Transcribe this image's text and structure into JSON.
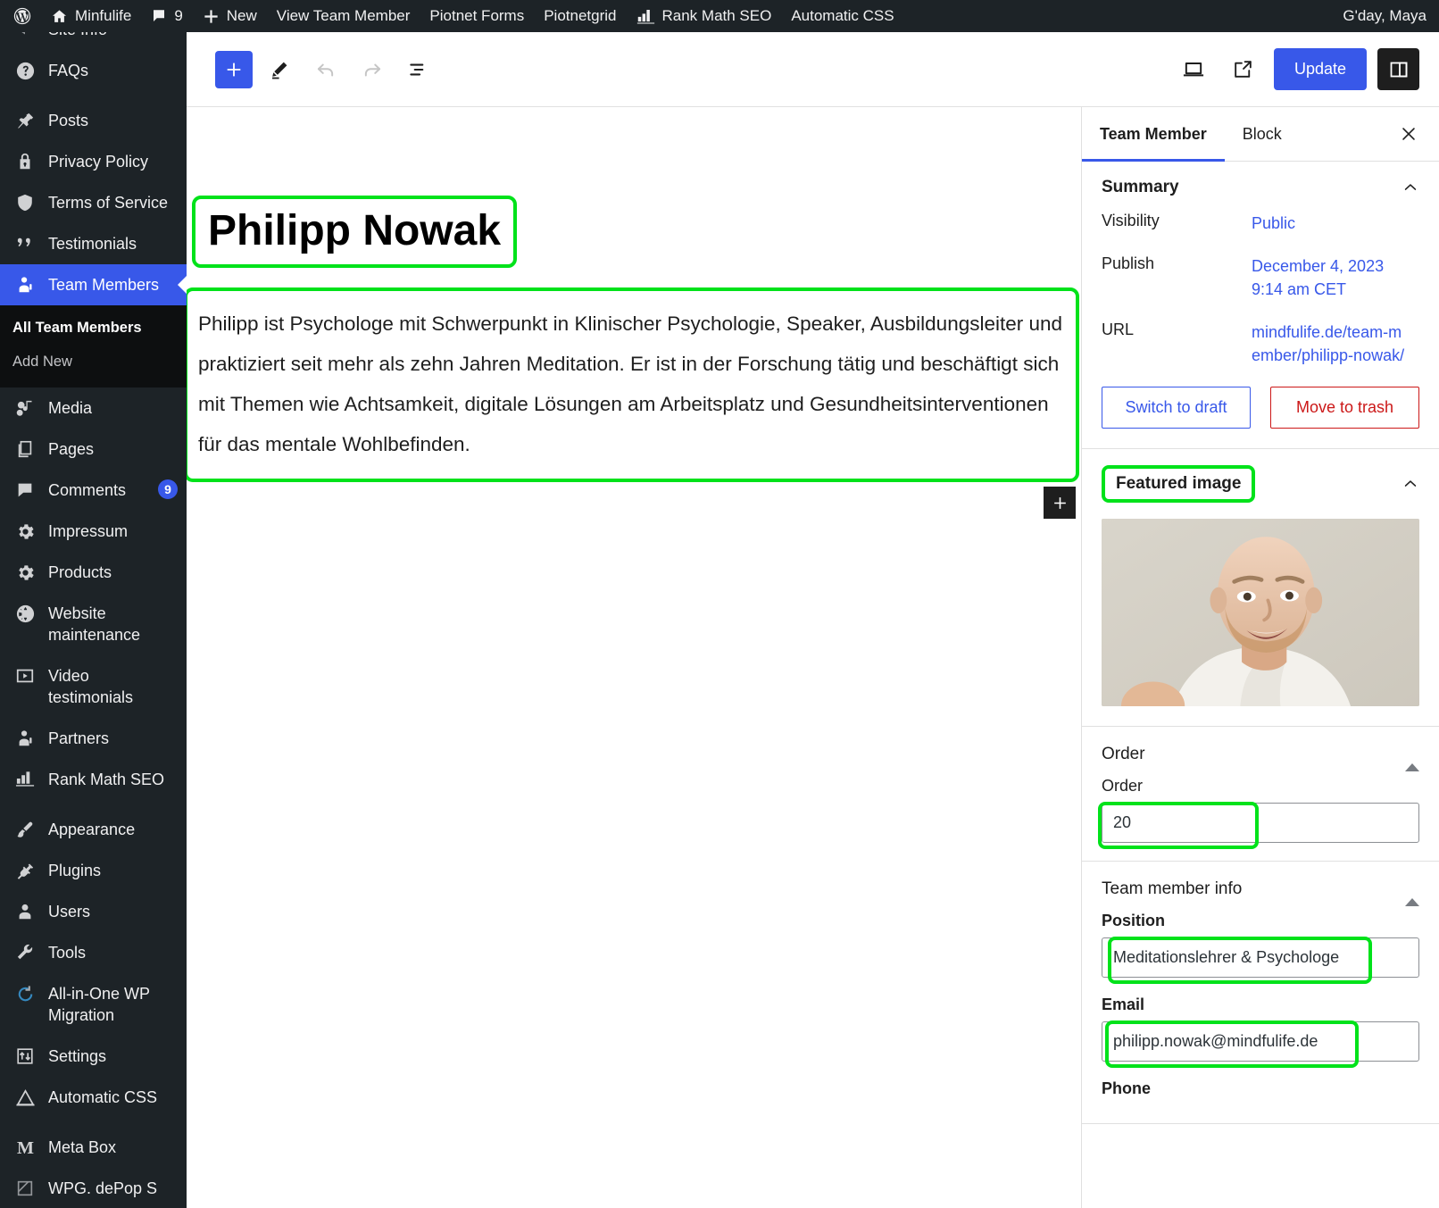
{
  "adminbar": {
    "logo_icon": "wordpress-logo-icon",
    "items": [
      {
        "icon": "home-icon",
        "label": "Minfulife"
      },
      {
        "icon": "comment-bubble-icon",
        "label": "9"
      },
      {
        "icon": "plus-icon",
        "label": "New"
      },
      {
        "icon": "",
        "label": "View Team Member"
      },
      {
        "icon": "",
        "label": "Piotnet Forms"
      },
      {
        "icon": "",
        "label": "Piotnetgrid"
      },
      {
        "icon": "rank-math-icon",
        "label": "Rank Math SEO"
      },
      {
        "icon": "",
        "label": "Automatic CSS"
      }
    ],
    "greeting": "G'day, Maya"
  },
  "sidebar": {
    "items": [
      {
        "label": "Site Info",
        "icon": "megaphone-icon",
        "current": false,
        "partial": true
      },
      {
        "label": "FAQs",
        "icon": "question-icon",
        "current": false
      },
      {
        "label": "Posts",
        "icon": "pin-icon",
        "current": false
      },
      {
        "label": "Privacy Policy",
        "icon": "lock-icon",
        "current": false
      },
      {
        "label": "Terms of Service",
        "icon": "shield-icon",
        "current": false
      },
      {
        "label": "Testimonials",
        "icon": "quote-icon",
        "current": false
      },
      {
        "label": "Team Members",
        "icon": "person-badge-icon",
        "current": true
      },
      {
        "label": "Media",
        "icon": "media-icon",
        "current": false
      },
      {
        "label": "Pages",
        "icon": "pages-icon",
        "current": false
      },
      {
        "label": "Comments",
        "icon": "comment-icon",
        "current": false,
        "badge": "9"
      },
      {
        "label": "Impressum",
        "icon": "gear-icon",
        "current": false
      },
      {
        "label": "Products",
        "icon": "gear-icon",
        "current": false
      },
      {
        "label": "Website maintenance",
        "icon": "globe-icon",
        "current": false
      },
      {
        "label": "Video testimonials",
        "icon": "video-icon",
        "current": false
      },
      {
        "label": "Partners",
        "icon": "user-icon",
        "current": false
      },
      {
        "label": "Rank Math SEO",
        "icon": "rank-math-icon",
        "current": false
      },
      {
        "label": "Appearance",
        "icon": "brush-icon",
        "current": false
      },
      {
        "label": "Plugins",
        "icon": "plug-icon",
        "current": false
      },
      {
        "label": "Users",
        "icon": "user-icon",
        "current": false
      },
      {
        "label": "Tools",
        "icon": "wrench-icon",
        "current": false
      },
      {
        "label": "All-in-One WP Migration",
        "icon": "migration-icon",
        "current": false
      },
      {
        "label": "Settings",
        "icon": "sliders-icon",
        "current": false
      },
      {
        "label": "Automatic CSS",
        "icon": "triangle-icon",
        "current": false
      },
      {
        "label": "Meta Box",
        "icon": "metabox-m-icon",
        "current": false
      },
      {
        "label": "WPG. dePop S",
        "icon": "cube-icon",
        "current": false,
        "partial": true
      }
    ],
    "submenu": {
      "items": [
        {
          "label": "All Team Members",
          "current": true
        },
        {
          "label": "Add New",
          "current": false
        }
      ]
    }
  },
  "toolbar": {
    "add_block_icon": "plus-icon",
    "tools_icon": "pencil-icon",
    "undo_icon": "undo-arrow-icon",
    "redo_icon": "redo-arrow-icon",
    "list_view_icon": "list-view-icon",
    "preview_icon": "desktop-preview-icon",
    "view_icon": "external-link-icon",
    "update_label": "Update",
    "settings_toggle_icon": "sidebar-panel-icon"
  },
  "editor": {
    "title": "Philipp Nowak",
    "paragraph": "Philipp ist Psychologe mit Schwerpunkt in Klinischer Psychologie, Speaker, Ausbildungsleiter und praktiziert seit mehr als zehn Jahren Meditation. Er ist in der Forschung tätig und beschäftigt sich mit Themen wie Achtsamkeit, digitale Lösungen am Arbeitsplatz und Gesundheitsinterventionen für das mentale Wohlbefinden.",
    "block_inserter_icon": "plus-icon"
  },
  "settings": {
    "tabs": [
      {
        "label": "Team Member",
        "active": true
      },
      {
        "label": "Block",
        "active": false
      }
    ],
    "close_icon": "close-icon",
    "summary": {
      "title": "Summary",
      "chevron_icon": "chevron-up-icon",
      "visibility_label": "Visibility",
      "visibility_value": "Public",
      "publish_label": "Publish",
      "publish_value": "December 4, 2023 9:14 am CET",
      "url_label": "URL",
      "url_value": "mindfulife.de/team-member/philipp-nowak/",
      "switch_to_draft": "Switch to draft",
      "move_to_trash": "Move to trash"
    },
    "featured_image": {
      "title": "Featured image",
      "chevron_icon": "chevron-up-icon",
      "alt": "portrait-photo-of-man"
    },
    "order": {
      "title": "Order",
      "toggle_icon": "triangle-up-icon",
      "field_label": "Order",
      "value": "20"
    },
    "team_member_info": {
      "title": "Team member info",
      "toggle_icon": "triangle-up-icon",
      "position_label": "Position",
      "position_value": "Meditationslehrer & Psychologe",
      "email_label": "Email",
      "email_value": "philipp.nowak@mindfulife.de",
      "phone_label": "Phone"
    }
  },
  "colors": {
    "wp_dark": "#1d2327",
    "accent_blue": "#3858e9",
    "highlight_green": "#00e21a",
    "danger_red": "#cc1818"
  }
}
